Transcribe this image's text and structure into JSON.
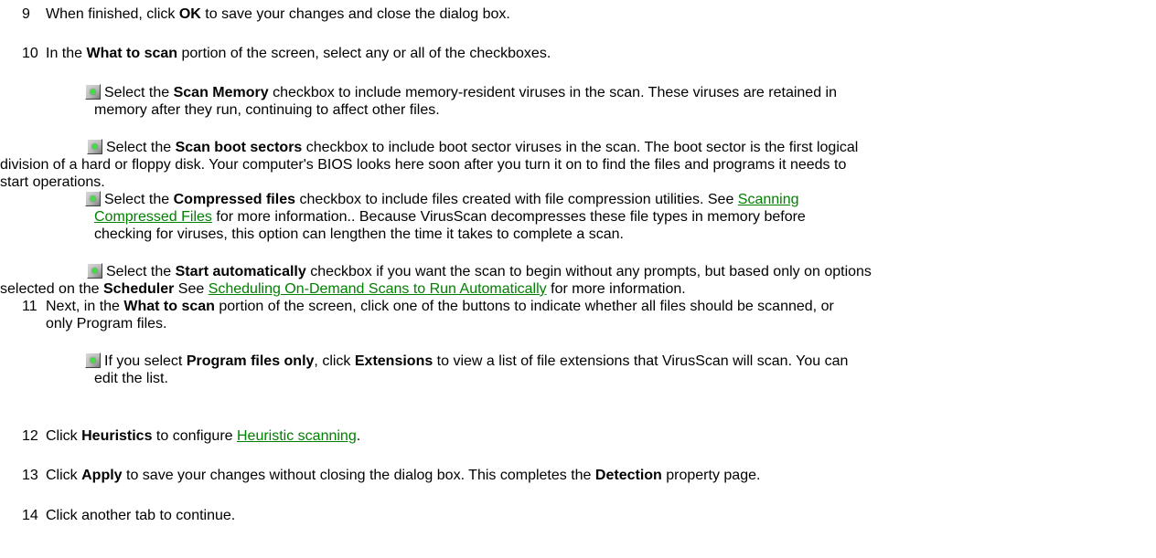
{
  "steps": {
    "s9": {
      "num": "9",
      "a": "When finished, click ",
      "b1": "OK",
      "c": " to save your changes and close the dialog box."
    },
    "s10": {
      "num": "10",
      "a": "In the ",
      "b1": "What to scan",
      "c": " portion of the screen, select any or all of the checkboxes."
    },
    "s11": {
      "num": "11",
      "a": "Next, in the ",
      "b1": "What to scan",
      "c": " portion of the screen, click one of the buttons to indicate whether all files should be scanned, or",
      "d": "only Program files."
    },
    "s12": {
      "num": "12",
      "a": "Click ",
      "b1": "Heuristics",
      "c": " to configure ",
      "link": "Heuristic scanning",
      "e": "."
    },
    "s13": {
      "num": "13",
      "a": "Click ",
      "b1": "Apply",
      "c": " to save your changes without closing the dialog box. This completes the ",
      "b2": "Detection",
      "e": " property page."
    },
    "s14": {
      "num": "14",
      "a": "Click another tab to continue."
    }
  },
  "bullets": {
    "memory": {
      "a": "Select the ",
      "b": "Scan Memory",
      "c": " checkbox to include memory-resident viruses in the scan. These viruses are retained in",
      "d": "memory after they run, continuing to affect other files."
    },
    "boot": {
      "a": "Select the ",
      "b": "Scan boot sectors",
      "c": " checkbox to include boot sector viruses in the scan. The boot sector is the first logical",
      "d": "division of a hard or floppy disk. Your computer's BIOS looks here soon after you turn it on to find the files and programs it needs to",
      "e": "start operations."
    },
    "compressed": {
      "a": "Select the ",
      "b": "Compressed files",
      "c": " checkbox to include files created with file compression utilities. See ",
      "link1": "Scanning",
      "link2": "Compressed Files",
      "d": " for more information.. Because VirusScan decompresses these file types in memory before",
      "e": "checking for viruses, this option can lengthen the time it takes to complete a scan."
    },
    "start": {
      "a": "Select the ",
      "b": "Start automatically",
      "c": " checkbox if you want the scan to begin without any prompts, but based only on options",
      "d": "selected on the ",
      "b2": "Scheduler",
      "e": " See ",
      "link": "Scheduling On-Demand Scans to Run Automatically",
      "f": " for more information."
    },
    "program": {
      "a": "If you select ",
      "b": "Program files only",
      "c": ", click ",
      "b2": "Extensions",
      "d": " to view a list of file extensions that VirusScan will scan. You can",
      "e": "edit the list."
    }
  },
  "icon_name": "bullet-square-icon",
  "link_color": "#008000"
}
